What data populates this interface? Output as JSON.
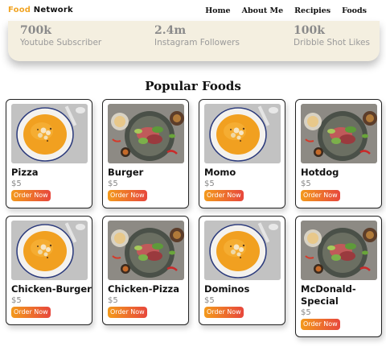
{
  "navbar": {
    "brand_accent": "Food",
    "brand_rest": " Network",
    "links": [
      "Home",
      "About Me",
      "Recipies",
      "Foods"
    ]
  },
  "stats": [
    {
      "value": "700k",
      "label": "Youtube Subscriber"
    },
    {
      "value": "2.4m",
      "label": "Instagram Followers"
    },
    {
      "value": "100k",
      "label": "Dribble Shot Likes"
    }
  ],
  "section_title": "Popular Foods",
  "foods": [
    {
      "name": "Pizza",
      "price": "$5",
      "button": "Order Now",
      "image": "soup-bowl"
    },
    {
      "name": "Burger",
      "price": "$5",
      "button": "Order Now",
      "image": "salad-platter"
    },
    {
      "name": "Momo",
      "price": "$5",
      "button": "Order Now",
      "image": "soup-bowl"
    },
    {
      "name": "Hotdog",
      "price": "$5",
      "button": "Order Now",
      "image": "salad-platter"
    },
    {
      "name": "Chicken-Burger",
      "price": "$5",
      "button": "Order Now",
      "image": "soup-bowl"
    },
    {
      "name": "Chicken-Pizza",
      "price": "$5",
      "button": "Order Now",
      "image": "salad-platter"
    },
    {
      "name": "Dominos",
      "price": "$5",
      "button": "Order Now",
      "image": "soup-bowl"
    },
    {
      "name": "McDonald-Special",
      "price": "$5",
      "button": "Order Now",
      "image": "salad-platter"
    }
  ],
  "colors": {
    "accent": "#f1a526",
    "button_start": "#f39a1c",
    "button_end": "#e7473c",
    "stats_bg": "#f4efe0"
  }
}
